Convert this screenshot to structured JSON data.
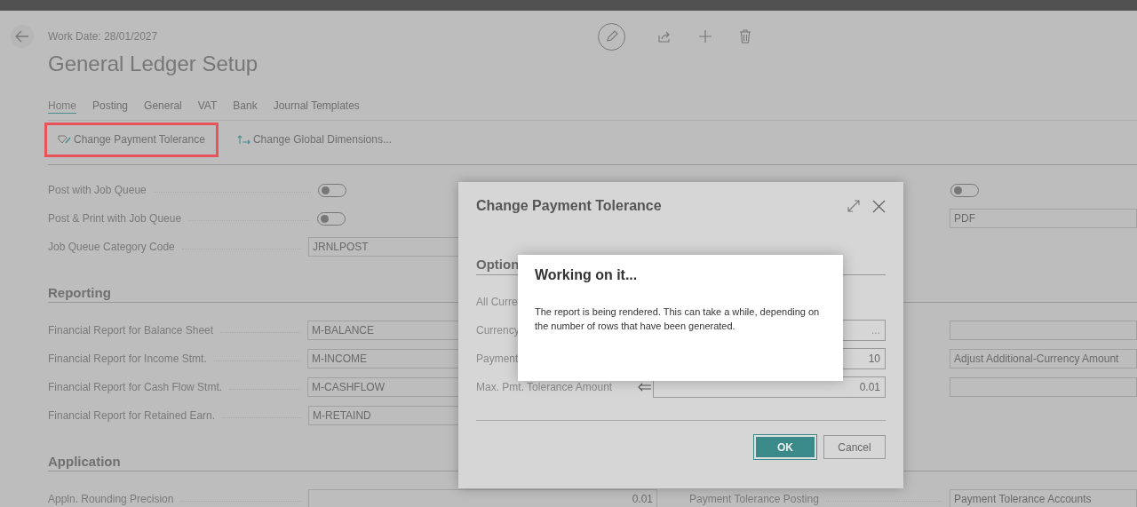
{
  "header": {
    "work_date": "Work Date: 28/01/2027",
    "title": "General Ledger Setup"
  },
  "tabs": [
    {
      "label": "Home",
      "selected": true
    },
    {
      "label": "Posting",
      "selected": false
    },
    {
      "label": "General",
      "selected": false
    },
    {
      "label": "VAT",
      "selected": false
    },
    {
      "label": "Bank",
      "selected": false
    },
    {
      "label": "Journal Templates",
      "selected": false
    }
  ],
  "actions": [
    {
      "label": "Change Payment Tolerance",
      "highlighted": true,
      "kind": "tolerance"
    },
    {
      "label": "Change Global Dimensions...",
      "highlighted": false,
      "kind": "dimensions"
    }
  ],
  "sections": [
    {
      "rows": [
        {
          "left": {
            "label": "Post with Job Queue",
            "kind": "toggle",
            "on": false
          },
          "right": {
            "kind": "toggle",
            "on": false
          }
        },
        {
          "left": {
            "label": "Post & Print with Job Queue",
            "kind": "toggle",
            "on": false
          },
          "right": {
            "kind": "text",
            "value": "PDF"
          }
        },
        {
          "left": {
            "label": "Job Queue Category Code",
            "kind": "text",
            "value": "JRNLPOST"
          }
        }
      ]
    },
    {
      "heading": "Reporting",
      "rows": [
        {
          "left": {
            "label": "Financial Report for Balance Sheet",
            "kind": "text",
            "value": "M-BALANCE"
          },
          "right": {
            "kind": "text"
          }
        },
        {
          "left": {
            "label": "Financial Report for Income Stmt.",
            "kind": "text",
            "value": "M-INCOME"
          },
          "right": {
            "kind": "text",
            "value": "Adjust Additional-Currency Amount"
          }
        },
        {
          "left": {
            "label": "Financial Report for Cash Flow Stmt.",
            "kind": "text",
            "value": "M-CASHFLOW"
          },
          "right": {
            "kind": "text"
          }
        },
        {
          "left": {
            "label": "Financial Report for Retained Earn.",
            "kind": "text",
            "value": "M-RETAIND"
          }
        }
      ]
    },
    {
      "heading": "Application",
      "rows": [
        {
          "left": {
            "label": "Appln. Rounding Precision",
            "kind": "number",
            "value": "0.01"
          },
          "right": {
            "label": "Payment Tolerance Posting",
            "kind": "text",
            "value": "Payment Tolerance Accounts"
          }
        }
      ]
    }
  ],
  "dialog": {
    "title": "Change Payment Tolerance",
    "section": "Option",
    "fields": [
      {
        "label": "All Curre",
        "kind": "none"
      },
      {
        "label": "Currency",
        "kind": "lookup",
        "button": "..."
      },
      {
        "label": "Payment",
        "kind": "number",
        "value": "10"
      },
      {
        "label": "Max. Pmt. Tolerance Amount",
        "kind": "number",
        "value": "0.01",
        "arrow": true
      }
    ],
    "buttons": [
      {
        "label": "OK",
        "primary": true
      },
      {
        "label": "Cancel",
        "primary": false
      }
    ]
  },
  "progress": {
    "title": "Working on it...",
    "message": "The report is being rendered. This can take a while, depending on the number of rows that have been generated."
  }
}
